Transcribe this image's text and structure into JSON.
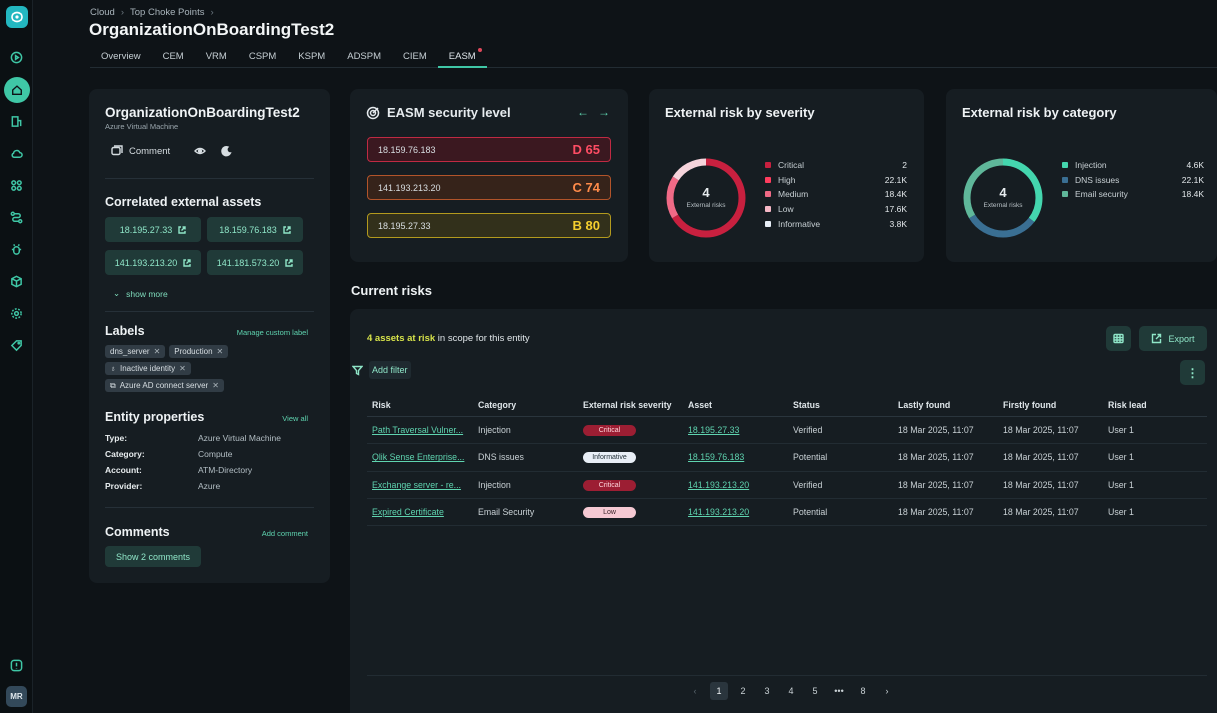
{
  "sidebar": {
    "avatar": "MR",
    "icons": [
      "app-logo",
      "play-circle-icon",
      "home-icon",
      "building-icon",
      "cloud-icon",
      "grid-icon",
      "route-icon",
      "bug-icon",
      "cube-icon",
      "settings-icon",
      "tag-icon",
      "help-icon"
    ]
  },
  "breadcrumb": [
    "Cloud",
    "Top Choke Points"
  ],
  "page_title": "OrganizationOnBoardingTest2",
  "tabs": [
    {
      "label": "Overview"
    },
    {
      "label": "CEM"
    },
    {
      "label": "VRM"
    },
    {
      "label": "CSPM"
    },
    {
      "label": "KSPM"
    },
    {
      "label": "ADSPM"
    },
    {
      "label": "CIEM"
    },
    {
      "label": "EASM",
      "active": true
    }
  ],
  "entity": {
    "name": "OrganizationOnBoardingTest2",
    "type": "Azure Virtual Machine",
    "comment_label": "Comment",
    "correlated_title": "Correlated external assets",
    "assets": [
      "18.195.27.33",
      "18.159.76.183",
      "141.193.213.20",
      "141.181.573.20"
    ],
    "show_more": "show more",
    "labels_title": "Labels",
    "manage_labels": "Manage custom label",
    "labels": [
      "dns_server",
      "Production",
      "Inactive identity",
      "Azure AD connect server"
    ],
    "properties_title": "Entity properties",
    "view_all": "View all",
    "properties": [
      {
        "key": "Type:",
        "value": "Azure Virtual Machine"
      },
      {
        "key": "Category:",
        "value": "Compute"
      },
      {
        "key": "Account:",
        "value": "ATM-Directory"
      },
      {
        "key": "Provider:",
        "value": "Azure"
      }
    ],
    "comments_title": "Comments",
    "add_comment": "Add comment",
    "show_comments": "Show 2 comments"
  },
  "easm": {
    "title": "EASM security level",
    "levels": [
      {
        "ip": "18.159.76.183",
        "grade": "D 65"
      },
      {
        "ip": "141.193.213.20",
        "grade": "C 74"
      },
      {
        "ip": "18.195.27.33",
        "grade": "B 80"
      }
    ]
  },
  "severity": {
    "title": "External risk by severity",
    "total": "4",
    "total_label": "External risks",
    "items": [
      {
        "name": "Critical",
        "value": "2",
        "color": "#c8203f"
      },
      {
        "name": "High",
        "value": "22.1K",
        "color": "#ff3d5e"
      },
      {
        "name": "Medium",
        "value": "18.4K",
        "color": "#f06a86"
      },
      {
        "name": "Low",
        "value": "17.6K",
        "color": "#f6b8c6"
      },
      {
        "name": "Informative",
        "value": "3.8K",
        "color": "#e7edf6"
      }
    ]
  },
  "category": {
    "title": "External risk by category",
    "total": "4",
    "total_label": "External risks",
    "items": [
      {
        "name": "Injection",
        "value": "4.6K",
        "color": "#44d6ae"
      },
      {
        "name": "DNS issues",
        "value": "22.1K",
        "color": "#3a6f93"
      },
      {
        "name": "Email security",
        "value": "18.4K",
        "color": "#5fb79a"
      }
    ]
  },
  "risks": {
    "section_title": "Current risks",
    "assets_at_risk": "4 assets at risk",
    "scope_text": "in scope for this entity",
    "export_label": "Export",
    "add_filter": "Add filter",
    "columns": [
      "Risk",
      "Category",
      "External risk severity",
      "Asset",
      "Status",
      "Lastly found",
      "Firstly found",
      "Risk lead"
    ],
    "rows": [
      {
        "risk": "Path Traversal Vulner...",
        "category": "Injection",
        "severity": "Critical",
        "sev_class": "critical",
        "asset": "18.195.27.33",
        "status": "Verified",
        "lastly": "18 Mar 2025, 11:07",
        "firstly": "18 Mar 2025, 11:07",
        "lead": "User 1"
      },
      {
        "risk": "Qlik Sense Enterprise...",
        "category": "DNS issues",
        "severity": "Informative",
        "sev_class": "informative",
        "asset": "18.159.76.183",
        "status": "Potential",
        "lastly": "18 Mar 2025, 11:07",
        "firstly": "18 Mar 2025, 11:07",
        "lead": "User 1"
      },
      {
        "risk": "Exchange server - re...",
        "category": "Injection",
        "severity": "Critical",
        "sev_class": "critical",
        "asset": "141.193.213.20",
        "status": "Verified",
        "lastly": "18 Mar 2025, 11:07",
        "firstly": "18 Mar 2025, 11:07",
        "lead": "User 1"
      },
      {
        "risk": "Expired Certificate",
        "category": "Email Security",
        "severity": "Low",
        "sev_class": "low",
        "asset": "141.193.213.20",
        "status": "Potential",
        "lastly": "18 Mar 2025, 11:07",
        "firstly": "18 Mar 2025, 11:07",
        "lead": "User 1"
      }
    ],
    "pages": [
      "1",
      "2",
      "3",
      "4",
      "5",
      "•••",
      "8"
    ],
    "current_page": "1"
  }
}
